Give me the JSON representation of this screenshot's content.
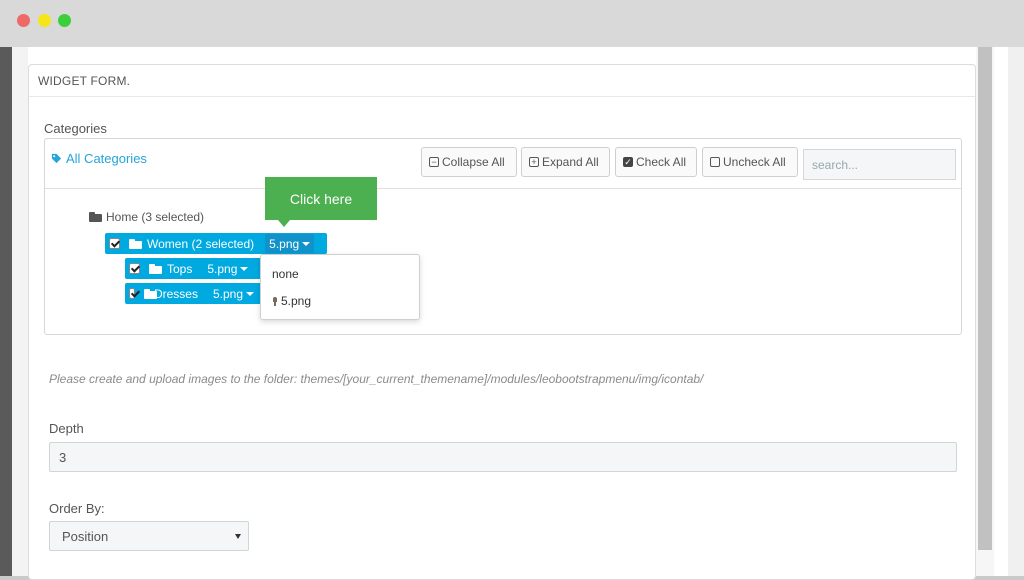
{
  "window": {
    "controls": [
      "close-dot",
      "minimize-dot",
      "maximize-dot"
    ]
  },
  "panel": {
    "heading": "WIDGET FORM."
  },
  "categories": {
    "label": "Categories",
    "all_link": "All Categories",
    "toolbar": {
      "collapse_all": "Collapse All",
      "expand_all": "Expand All",
      "check_all": "Check All",
      "uncheck_all": "Uncheck All"
    },
    "search_placeholder": "search...",
    "tree": {
      "home": "Home (3 selected)",
      "women": {
        "label": "Women (2 selected)",
        "image": "5.png",
        "checked": true
      },
      "tops": {
        "label": "Tops",
        "image": "5.png",
        "checked": true
      },
      "dresses": {
        "label": "Dresses",
        "image": "5.png",
        "checked": true
      }
    },
    "dropdown": {
      "options": [
        "none",
        "5.png"
      ]
    },
    "tooltip": "Click here"
  },
  "help_text": "Please create and upload images to the folder: themes/[your_current_themename]/modules/leobootstrapmenu/img/icontab/",
  "depth": {
    "label": "Depth",
    "value": "3"
  },
  "order_by": {
    "label": "Order By:",
    "value": "Position"
  },
  "colors": {
    "selected_node": "#00a9e0",
    "tooltip": "#4caf50",
    "link": "#25a5d8"
  }
}
